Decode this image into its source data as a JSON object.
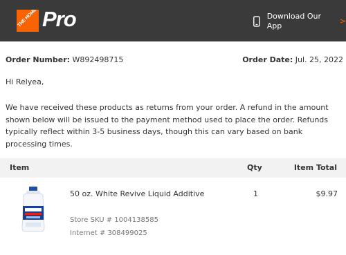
{
  "header": {
    "logo_text": "THE HOME DEPOT",
    "brand_suffix": "Pro",
    "download_label": "Download Our App",
    "download_chevron": ">",
    "phone_icon": "phone-icon",
    "background_color": "#3a3a3a",
    "accent_color": "#f96302"
  },
  "order": {
    "number_label": "Order Number:",
    "number": "W892498715",
    "date_label": "Order Date:",
    "date": "Jul. 25, 2022"
  },
  "greeting": "Hi Relyea,",
  "message": "We have received these products as returns from your order. A refund in the amount shown below will be issued to the payment method used to place the order. Refunds typically reflect within 3-5 business days, though this can vary based on bank processing times.",
  "table": {
    "columns": [
      "Item",
      "Qty",
      "Item Total"
    ],
    "rows": [
      {
        "name": "50 oz. White Revive Liquid Additive",
        "qty": "1",
        "total": "$9.97",
        "store_sku": "Store SKU # 1004138585",
        "internet": "Internet # 308499025",
        "image": "product-bottle-image"
      }
    ]
  }
}
